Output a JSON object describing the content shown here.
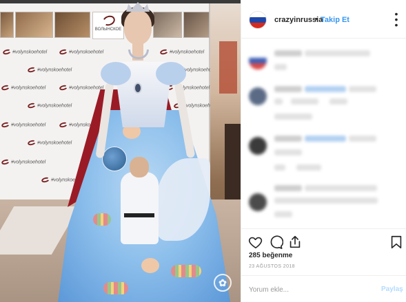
{
  "post": {
    "username": "crazyinrussia",
    "separator": "•",
    "follow_label": "Takip Et",
    "more_icon": "more-options-icon",
    "avatar_colors": [
      "#ffffff",
      "#1f47a8",
      "#d52b1e"
    ]
  },
  "photo_backdrop": {
    "hotel_name": "ВОЛЫНСКОЕ",
    "step_and_repeat": "#volynskoehotel"
  },
  "actions": {
    "like_icon": "heart-icon",
    "comment_icon": "comment-icon",
    "share_icon": "share-icon",
    "save_icon": "bookmark-icon"
  },
  "likes_text": "285 beğenme",
  "date_text": "23 AĞUSTOS 2018",
  "comment_box": {
    "placeholder": "Yorum ekle...",
    "submit_label": "Paylaş"
  },
  "colors": {
    "link_blue": "#3897f0",
    "submit_disabled": "#b3dbff",
    "text": "#262626",
    "muted": "#999999",
    "divider": "#efefef"
  }
}
